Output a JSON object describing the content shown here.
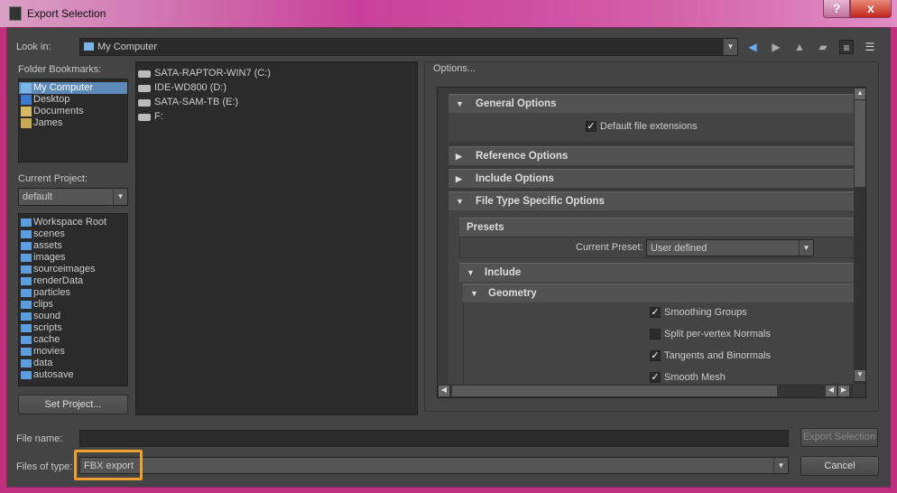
{
  "window": {
    "title": "Export Selection",
    "help": "?",
    "close": "x"
  },
  "look_in": {
    "label": "Look in:",
    "value": "My Computer"
  },
  "toolbar": {
    "icons": [
      "back-arrow-icon",
      "forward-arrow-icon",
      "up-arrow-icon",
      "new-folder-icon",
      "list-view-icon",
      "detail-view-icon"
    ]
  },
  "bookmarks": {
    "label": "Folder Bookmarks:",
    "items": [
      "My Computer",
      "Desktop",
      "Documents",
      "James"
    ],
    "selected": "My Computer"
  },
  "project": {
    "label": "Current Project:",
    "value": "default",
    "folders": [
      "Workspace Root",
      "scenes",
      "assets",
      "images",
      "sourceimages",
      "renderData",
      "particles",
      "clips",
      "sound",
      "scripts",
      "cache",
      "movies",
      "data",
      "autosave"
    ],
    "set_button": "Set Project..."
  },
  "drives": [
    "SATA-RAPTOR-WIN7 (C:)",
    "IDE-WD800 (D:)",
    "SATA-SAM-TB (E:)",
    "F:"
  ],
  "options": {
    "label": "Options...",
    "general": {
      "title": "General Options",
      "default_ext": "Default file extensions",
      "default_ext_checked": true
    },
    "reference": "Reference Options",
    "include_opts": "Include Options",
    "file_type": "File Type Specific Options",
    "presets": {
      "title": "Presets",
      "current_label": "Current Preset:",
      "current_value": "User defined"
    },
    "include": "Include",
    "geometry": "Geometry",
    "geometry_options": [
      {
        "label": "Smoothing Groups",
        "checked": true
      },
      {
        "label": "Split per-vertex Normals",
        "checked": false
      },
      {
        "label": "Tangents and Binormals",
        "checked": true
      },
      {
        "label": "Smooth Mesh",
        "checked": true
      }
    ]
  },
  "file_name": {
    "label": "File name:",
    "value": ""
  },
  "files_of_type": {
    "label": "Files of type:",
    "value": "FBX export",
    "highlight_color": "#f0a030"
  },
  "buttons": {
    "export": "Export Selection",
    "cancel": "Cancel"
  }
}
